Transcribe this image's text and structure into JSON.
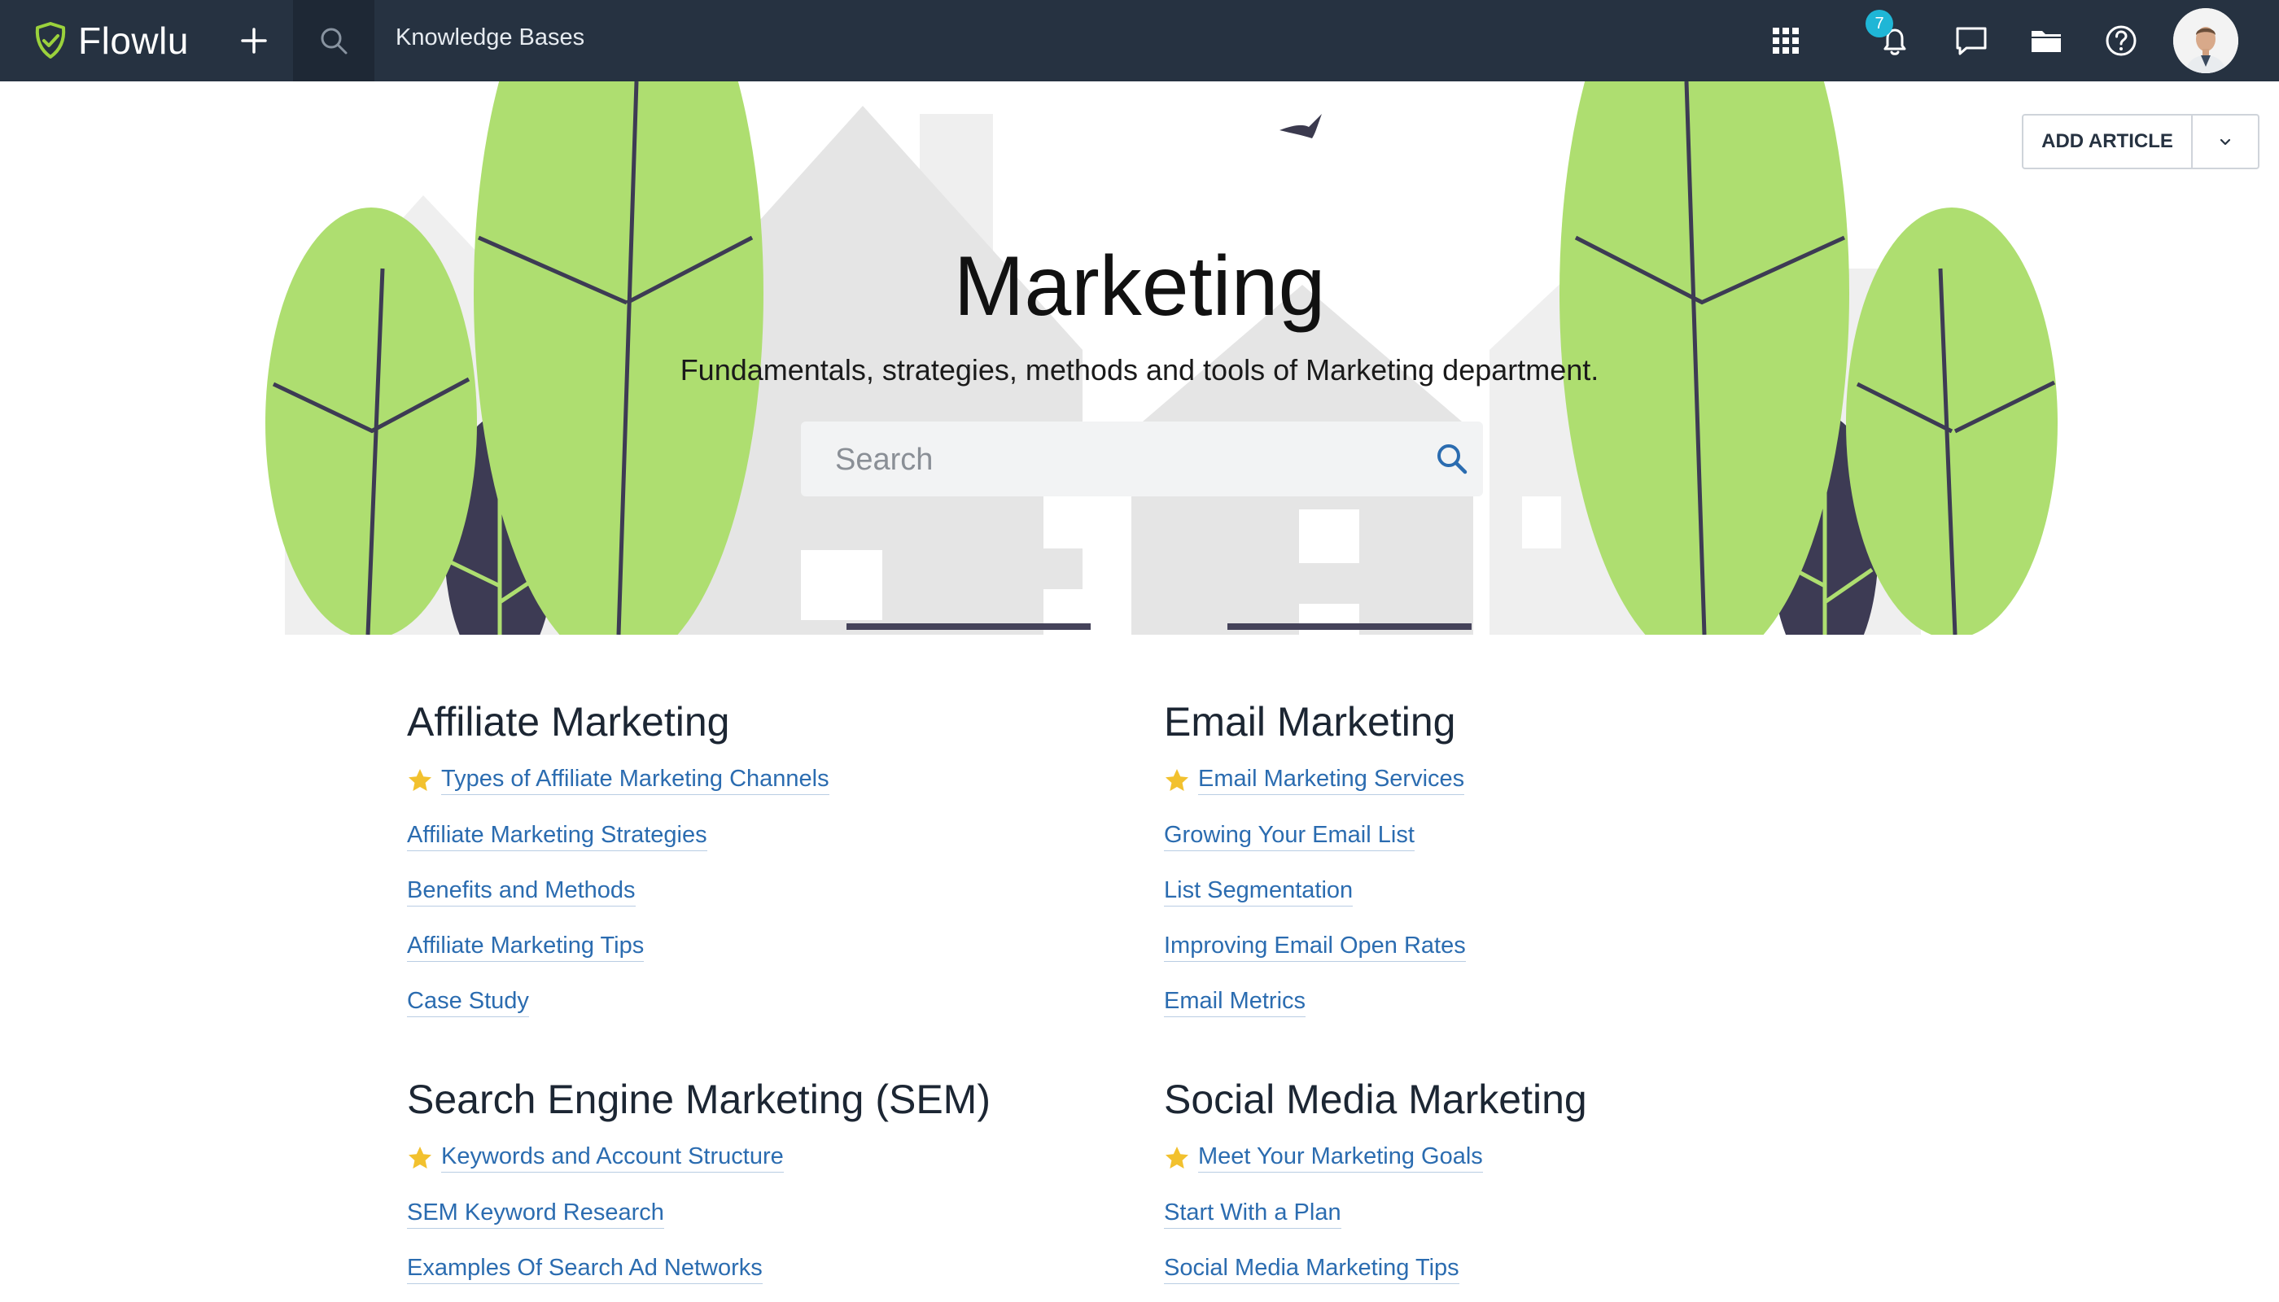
{
  "app": {
    "name": "Flowlu"
  },
  "topbar": {
    "breadcrumb": "Knowledge Bases",
    "notification_count": "7",
    "icons": [
      "plus-icon",
      "search-icon",
      "apps-grid-icon",
      "bell-icon",
      "chat-icon",
      "folder-icon",
      "help-icon",
      "avatar"
    ]
  },
  "hero": {
    "title": "Marketing",
    "subtitle": "Fundamentals, strategies, methods and tools of Marketing department.",
    "search_placeholder": "Search"
  },
  "actions": {
    "add_article": "ADD ARTICLE"
  },
  "colors": {
    "topbar": "#263241",
    "link": "#2b6cb0",
    "leaf": "#aede70",
    "accent_green": "#9bd23c",
    "star": "#f2c12e"
  },
  "sections": [
    {
      "title": "Affiliate Marketing",
      "articles": [
        {
          "title": "Types of Affiliate Marketing Channels",
          "starred": true
        },
        {
          "title": "Affiliate Marketing Strategies"
        },
        {
          "title": "Benefits and Methods"
        },
        {
          "title": "Affiliate Marketing Tips"
        },
        {
          "title": "Case Study"
        }
      ]
    },
    {
      "title": "Email Marketing",
      "articles": [
        {
          "title": "Email Marketing Services",
          "starred": true
        },
        {
          "title": "Growing Your Email List"
        },
        {
          "title": "List Segmentation"
        },
        {
          "title": "Improving Email Open Rates"
        },
        {
          "title": "Email Metrics"
        }
      ]
    },
    {
      "title": "Search Engine Marketing (SEM)",
      "articles": [
        {
          "title": "Keywords and Account Structure",
          "starred": true
        },
        {
          "title": "SEM Keyword Research"
        },
        {
          "title": "Examples Of Search Ad Networks"
        }
      ]
    },
    {
      "title": "Social Media Marketing",
      "articles": [
        {
          "title": "Meet Your Marketing Goals",
          "starred": true
        },
        {
          "title": "Start With a Plan"
        },
        {
          "title": "Social Media Marketing Tips"
        }
      ]
    }
  ]
}
